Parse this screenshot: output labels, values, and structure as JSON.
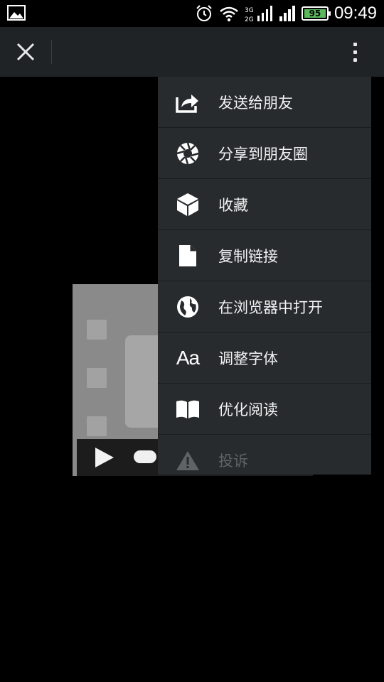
{
  "status_bar": {
    "network_label": "3G 2G",
    "battery_level": "95",
    "time": "09:49",
    "icons": [
      "image-icon",
      "alarm-icon",
      "wifi-icon",
      "signal-3g-icon",
      "signal-icon",
      "battery-icon"
    ]
  },
  "title_bar": {
    "close_icon": "close-icon",
    "more_icon": "more-vertical-icon"
  },
  "video": {
    "play_icon": "play-icon"
  },
  "menu": {
    "items": [
      {
        "label": "发送给朋友",
        "icon": "share-send-icon"
      },
      {
        "label": "分享到朋友圈",
        "icon": "moments-aperture-icon"
      },
      {
        "label": "收藏",
        "icon": "favorite-cube-icon"
      },
      {
        "label": "复制链接",
        "icon": "copy-link-document-icon"
      },
      {
        "label": "在浏览器中打开",
        "icon": "globe-icon"
      },
      {
        "label": "调整字体",
        "icon": "font-size-icon",
        "glyph": "Aa"
      },
      {
        "label": "优化阅读",
        "icon": "book-icon"
      },
      {
        "label": "投诉",
        "icon": "warning-icon",
        "disabled": true
      }
    ]
  },
  "colors": {
    "title_bar_bg": "#1f2325",
    "menu_bg": "#272b2d",
    "battery": "#5cb85c"
  }
}
